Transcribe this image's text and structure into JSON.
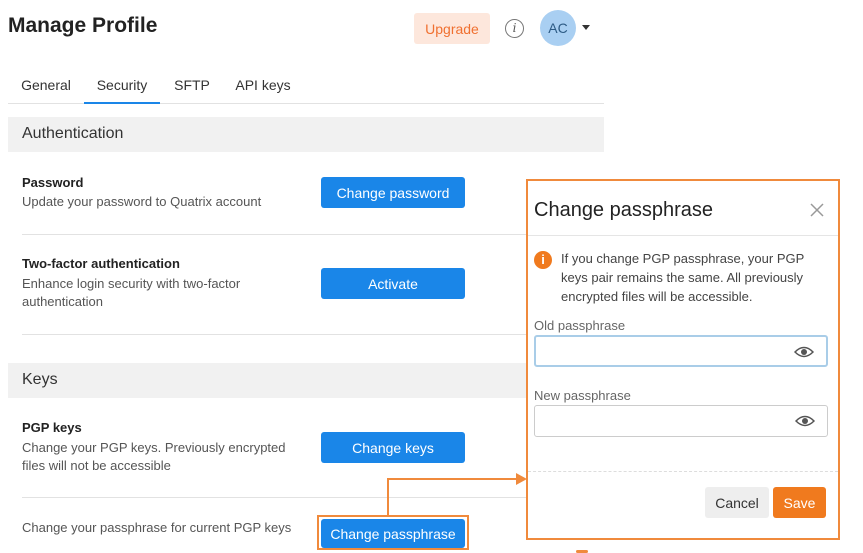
{
  "header": {
    "title": "Manage Profile",
    "upgrade_label": "Upgrade",
    "info_glyph": "i",
    "avatar_initials": "AC"
  },
  "tabs": [
    {
      "label": "General",
      "active": false
    },
    {
      "label": "Security",
      "active": true
    },
    {
      "label": "SFTP",
      "active": false
    },
    {
      "label": "API keys",
      "active": false
    }
  ],
  "authentication": {
    "heading": "Authentication",
    "password": {
      "title": "Password",
      "description": "Update your password to Quatrix account",
      "button": "Change password"
    },
    "two_factor": {
      "title": "Two-factor authentication",
      "description_line1": "Enhance login security with two-factor",
      "description_line2": "authentication",
      "button": "Activate"
    }
  },
  "keys": {
    "heading": "Keys",
    "pgp": {
      "title": "PGP keys",
      "description_line1": "Change your PGP keys. Previously encrypted",
      "description_line2": "files will not be accessible",
      "button": "Change keys"
    },
    "passphrase": {
      "description": "Change your passphrase for current PGP keys",
      "button": "Change passphrase"
    }
  },
  "modal": {
    "title": "Change passphrase",
    "warning_glyph": "i",
    "message": "If you change PGP passphrase, your PGP keys pair remains the same. All previously encrypted files will be accessible.",
    "old_label": "Old passphrase",
    "old_value": "",
    "new_label": "New passphrase",
    "new_value": "",
    "cancel_label": "Cancel",
    "save_label": "Save"
  },
  "colors": {
    "primary": "#1a86e8",
    "accent": "#f07a1e",
    "highlight": "#f08a3c"
  }
}
